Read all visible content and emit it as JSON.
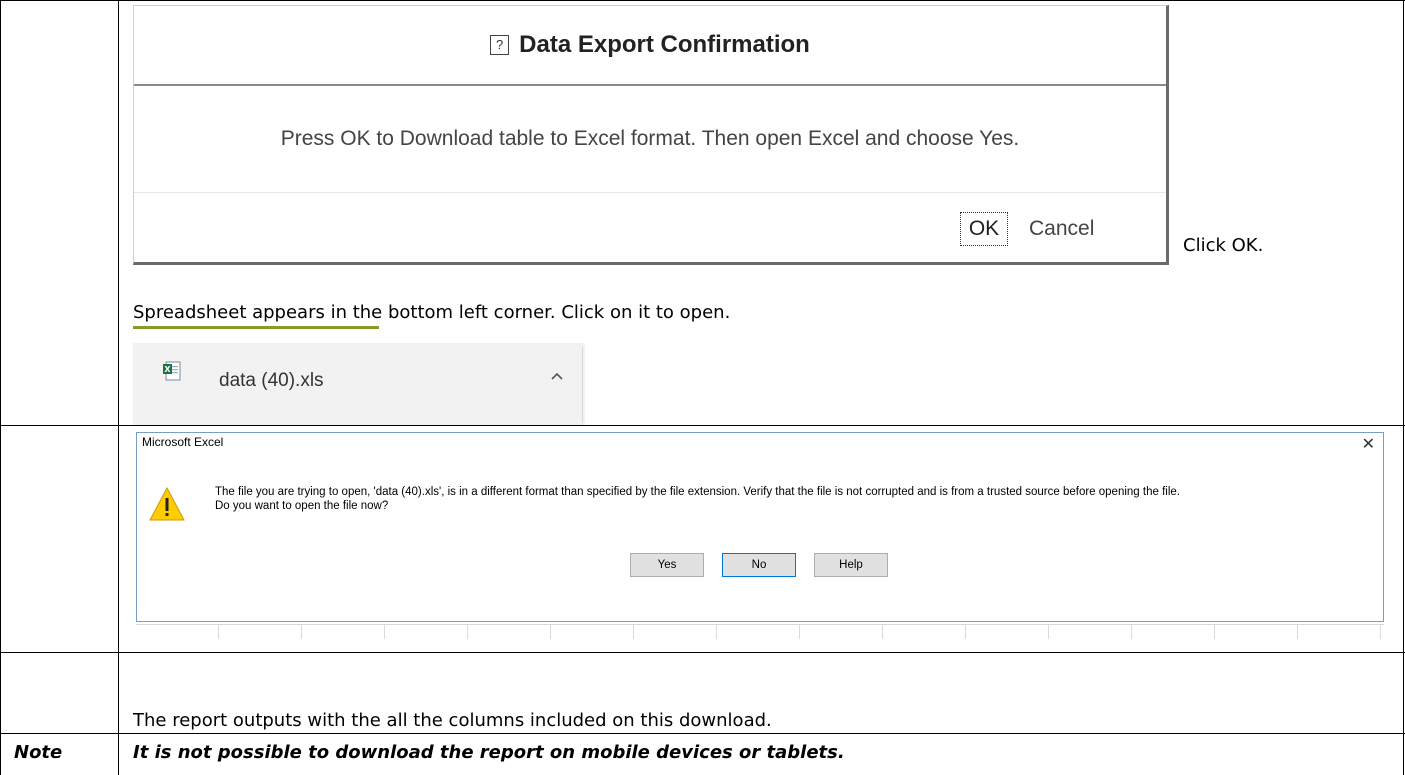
{
  "sap_dialog": {
    "help_glyph": "?",
    "title": "Data Export Confirmation",
    "message": "Press OK to Download table to Excel format. Then open Excel and choose Yes.",
    "ok_label": "OK",
    "cancel_label": "Cancel"
  },
  "row1": {
    "click_note": "Click OK.",
    "spreadsheet_text": "Spreadsheet appears in the bottom left corner.  Click on it to open."
  },
  "download_bar": {
    "file_name": "data (40).xls",
    "icon": "excel-file-icon",
    "chevron": "chevron-up-icon"
  },
  "excel_dialog": {
    "title": "Microsoft Excel",
    "close_glyph": "✕",
    "icon": "warning-icon",
    "message_line1": "The file you are trying to open, 'data (40).xls', is in a different format than specified by the file extension. Verify that the file is not corrupted and is from a trusted source before opening the file.",
    "message_line2": "Do you want to open the file now?",
    "yes_label": "Yes",
    "no_label": "No",
    "help_label": "Help"
  },
  "row3": {
    "text": "The report outputs with the all the columns included on this download."
  },
  "note_row": {
    "label": "Note",
    "text": "It is not possible to download the report on mobile devices or tablets."
  }
}
